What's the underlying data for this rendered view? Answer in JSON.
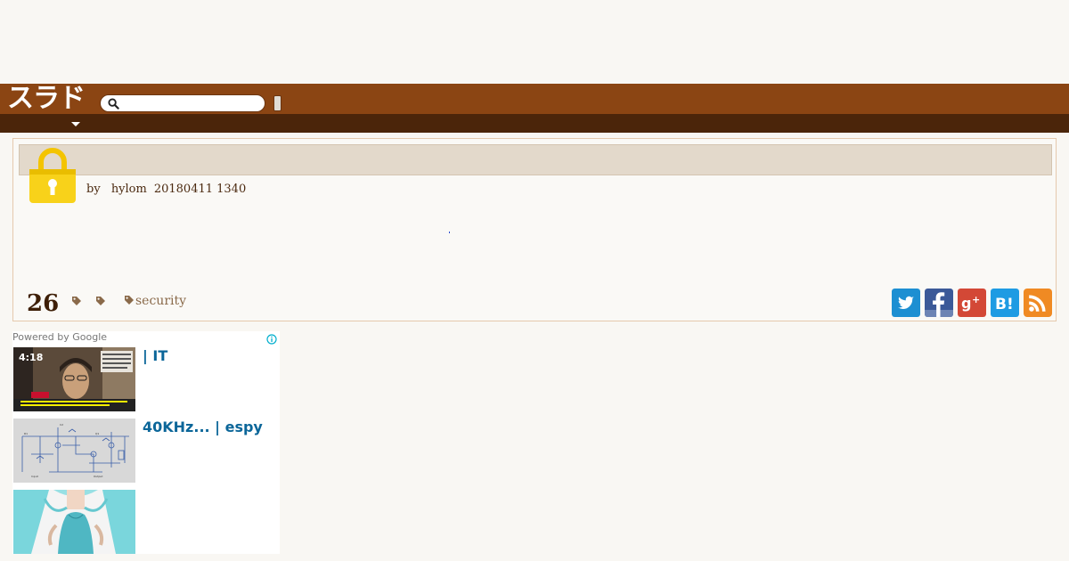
{
  "header": {
    "logo_text": "スラド",
    "search": {
      "placeholder": "",
      "value": ""
    },
    "search_button_label": "",
    "brand_color": "#8b4513",
    "nav_color": "#4b250a"
  },
  "story": {
    "title": "",
    "topic_icon": "lock-icon",
    "byline": {
      "prefix": "by",
      "author": "hylom",
      "datetime": "20180411 1340"
    },
    "comment_count": "26",
    "tags": [
      "security"
    ],
    "share_icons": [
      "twitter-icon",
      "facebook-icon",
      "google-plus-icon",
      "hatena-bookmark-icon",
      "rss-icon"
    ]
  },
  "ads": {
    "powered_by": "Powered by Google",
    "items": [
      {
        "title": "| IT",
        "thumb_caption": "4:18"
      },
      {
        "title": "40KHz... | espy"
      },
      {
        "title": ""
      }
    ]
  }
}
